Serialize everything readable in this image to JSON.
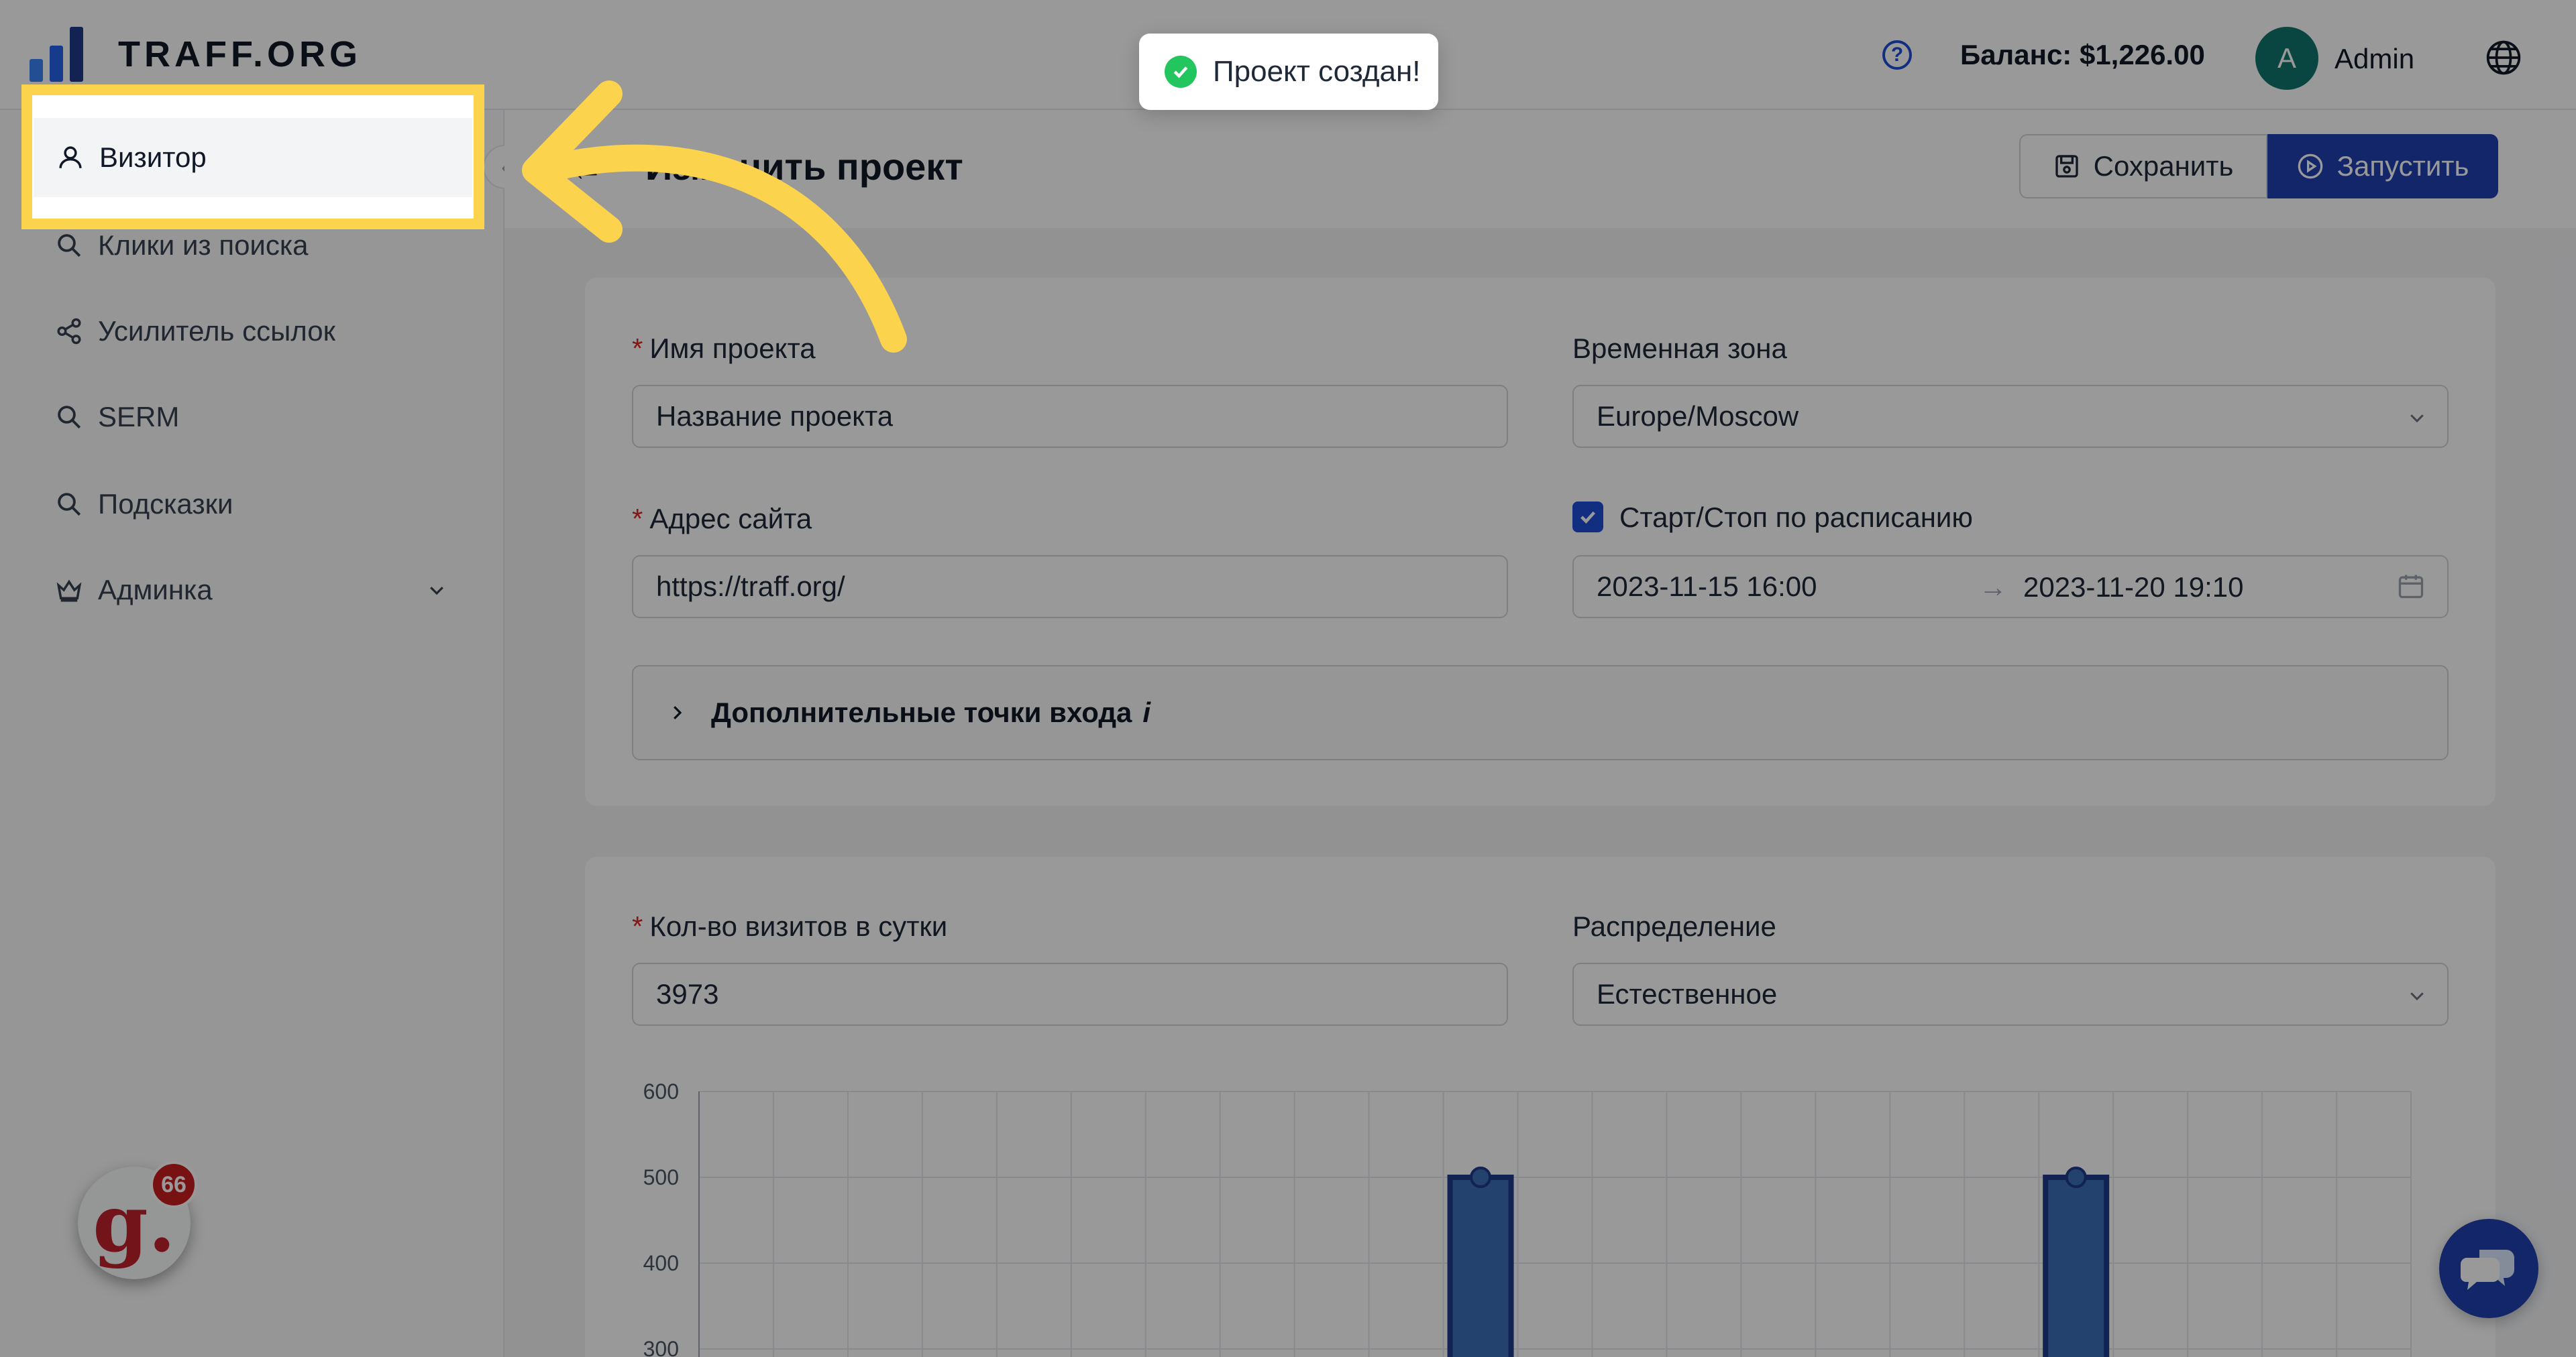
{
  "header": {
    "logo_text": "TRAFF.ORG",
    "balance": "Баланс: $1,226.00",
    "avatar_letter": "A",
    "username": "Admin",
    "help_icon": "question-circle-icon",
    "language_icon": "globe-icon"
  },
  "toast": {
    "text": "Проект создан!",
    "icon": "check-circle-icon"
  },
  "sidebar": {
    "items": [
      {
        "label": "Визитор",
        "icon": "user-icon"
      },
      {
        "label": "Клики из поиска",
        "icon": "search-icon"
      },
      {
        "label": "Усилитель ссылок",
        "icon": "share-icon"
      },
      {
        "label": "SERM",
        "icon": "search-icon"
      },
      {
        "label": "Подсказки",
        "icon": "search-icon"
      },
      {
        "label": "Админка",
        "icon": "crown-icon"
      }
    ],
    "badge_letter": "g.",
    "badge_count": "66"
  },
  "page": {
    "title": "Изменить проект",
    "save_label": "Сохранить",
    "run_label": "Запустить"
  },
  "form": {
    "project_name": {
      "label": "Имя проекта",
      "value": "Название проекта"
    },
    "timezone": {
      "label": "Временная зона",
      "value": "Europe/Moscow"
    },
    "site_url": {
      "label": "Адрес сайта",
      "value": "https://traff.org/"
    },
    "schedule": {
      "label": "Старт/Стоп по расписанию",
      "checked": true,
      "start": "2023-11-15 16:00",
      "separator": "→",
      "end": "2023-11-20 19:10"
    },
    "extra_entry_points": {
      "label": "Дополнительные точки входа",
      "info": "i"
    },
    "visits_per_day": {
      "label": "Кол-во визитов в сутки",
      "value": "3973"
    },
    "distribution": {
      "label": "Распределение",
      "value": "Естественное"
    }
  },
  "chart_data": {
    "type": "bar",
    "y_ticks": [
      600,
      500,
      400,
      300
    ],
    "ylim": [
      300,
      600
    ],
    "grid": true,
    "columns": 23,
    "bars": [
      {
        "column": 10,
        "value": 500
      },
      {
        "column": 18,
        "value": 500
      }
    ],
    "bar_color": "#3b6fb6",
    "bar_edge_color": "#1e3a8a"
  },
  "colors": {
    "accent": "#1e40af",
    "highlight": "#fcd34d",
    "success": "#22c55e",
    "required": "#dc2626"
  }
}
